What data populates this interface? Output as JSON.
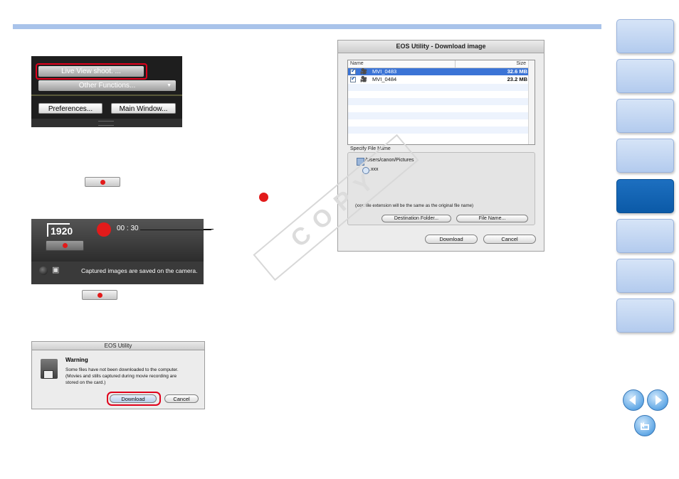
{
  "panel1": {
    "live_view": "Live View shoot. ...",
    "other_functions": "Other Functions...",
    "dropdown_arrow": "▼",
    "preferences": "Preferences...",
    "main_window": "Main Window..."
  },
  "liveview": {
    "resolution": "1920",
    "timer": "00 : 30",
    "status": "Captured images are saved on the camera."
  },
  "warning_dialog": {
    "title": "EOS Utility",
    "heading": "Warning",
    "message_line1": "Some files have not been downloaded to the computer.",
    "message_line2": "(Movies and stills captured during movie recording are",
    "message_line3": "stored on the card.)",
    "download": "Download",
    "cancel": "Cancel"
  },
  "download_dialog": {
    "title": "EOS Utility - Download image",
    "col_name": "Name",
    "col_size": "Size",
    "files": [
      {
        "name": "MVI_0483",
        "size": "32.6 MB",
        "selected": true
      },
      {
        "name": "MVI_0484",
        "size": "23.2 MB",
        "selected": false
      }
    ],
    "section_label": "Specify File Name",
    "path": "/Users/canon/Pictures",
    "filename": ".xxx",
    "note": "(xxx: file extension will be the same as the original file name)",
    "destination_folder": "Destination Folder...",
    "file_name": "File Name...",
    "download": "Download",
    "cancel": "Cancel"
  },
  "watermark": "COPY",
  "colors": {
    "accent_bar": "#a9c3ea",
    "tab_active": "#0b5aa7",
    "record_red": "#e21a1a",
    "highlight_red": "#e0001b",
    "selection_blue": "#3b74d6"
  },
  "icons": {
    "record": "red-dot",
    "prev": "arrow-left-icon",
    "next": "arrow-right-icon",
    "back": "return-icon"
  }
}
